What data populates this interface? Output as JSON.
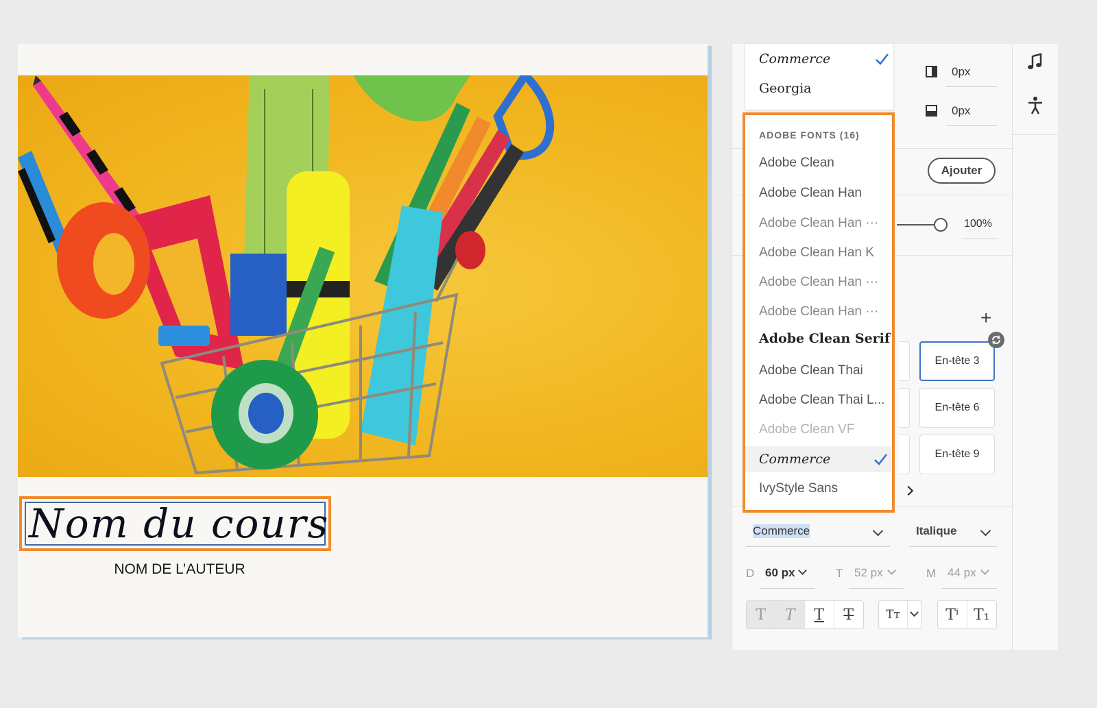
{
  "canvas": {
    "title": "Nom du cours",
    "author": "NOM DE L’AUTEUR"
  },
  "font_menu": {
    "top_items": [
      {
        "label": "Commerce",
        "checked": true
      },
      {
        "label": "Georgia",
        "checked": false
      }
    ],
    "group_header": "ADOBE FONTS (16)",
    "items": [
      {
        "label": "Adobe Clean"
      },
      {
        "label": "Adobe Clean Han"
      },
      {
        "label": "Adobe Clean Han ···"
      },
      {
        "label": "Adobe Clean Han K"
      },
      {
        "label": "Adobe Clean Han ···"
      },
      {
        "label": "Adobe Clean Han ···"
      },
      {
        "label": "Adobe Clean Serif"
      },
      {
        "label": "Adobe Clean Thai"
      },
      {
        "label": "Adobe Clean Thai L..."
      },
      {
        "label": "Adobe Clean VF"
      },
      {
        "label": "Commerce",
        "checked": true
      },
      {
        "label": "IvyStyle Sans"
      }
    ]
  },
  "panel": {
    "border_right": "0px",
    "border_bottom": "0px",
    "add_button": "Ajouter",
    "opacity": "100%",
    "styles": [
      "En-tête 3",
      "En-tête 6",
      "En-tête 9"
    ],
    "font_family": "Commerce",
    "font_style": "Italique",
    "size_desktop_label": "D",
    "size_desktop": "60 px",
    "size_tablet_label": "T",
    "size_tablet": "52 px",
    "size_mobile_label": "M",
    "size_mobile": "44 px"
  },
  "colors": {
    "highlight": "#f08a2c",
    "selection_blue": "#3e73c5",
    "check_blue": "#2f6fd0"
  }
}
